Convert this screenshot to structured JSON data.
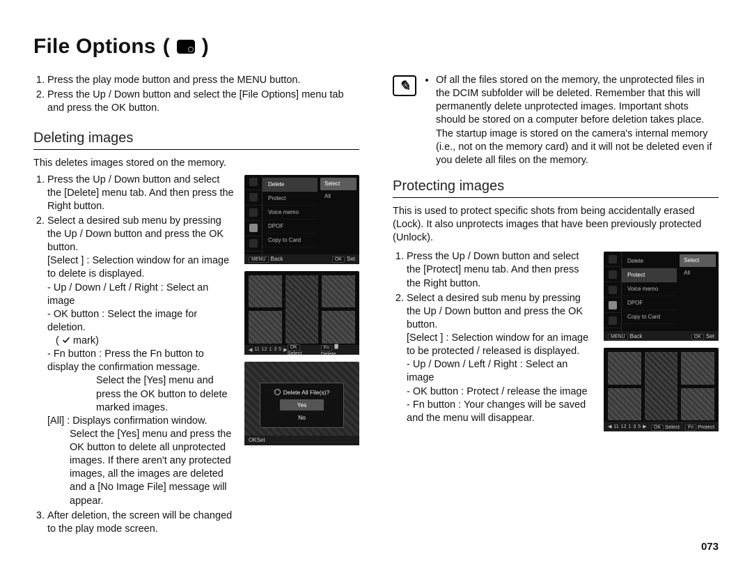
{
  "title": "File Options",
  "paren_open": "(",
  "paren_close": ")",
  "intro_steps": {
    "s1": "Press the play mode button and press the MENU button.",
    "s2": "Press the Up / Down button and select the [File Options] menu tab and press the OK button."
  },
  "deleting": {
    "heading": "Deleting images",
    "lead": "This deletes images stored on the memory.",
    "s1": "Press the Up / Down button and select the [Delete] menu tab. And then press the Right button.",
    "s2": "Select a desired sub menu by pressing the Up / Down button and press the OK button.",
    "select_label": "[Select ] : Selection window for an image to delete is displayed.",
    "nav_line": "- Up / Down / Left / Right : Select an image",
    "ok_line_a": "- OK button : Select the image for deletion.",
    "ok_line_b": "mark)",
    "ok_line_open": "(",
    "fn_line_a": "- Fn button : Press the Fn button to display the confirmation message.",
    "fn_line_b": "Select the [Yes] menu and press the OK button to delete marked images.",
    "all_line_a": "[All] : Displays confirmation window.",
    "all_line_b": "Select the [Yes] menu and press the OK button to delete all unprotected images. If there aren't any protected images, all the images are deleted and a [No Image File] message will appear.",
    "s3": "After deletion, the screen will be changed to the play mode screen."
  },
  "note": {
    "text": "Of all the files stored on the memory, the unprotected files in the DCIM subfolder will be deleted. Remember that this will permanently delete unprotected images. Important shots should be stored on a computer before deletion takes place. The startup image is stored on the camera's internal memory (i.e., not on the memory card) and it will not be deleted even if you delete all files on the memory."
  },
  "protecting": {
    "heading": "Protecting images",
    "lead": "This is used to protect specific shots from being accidentally erased (Lock). It also unprotects images that have been previously protected (Unlock).",
    "s1": "Press the Up / Down button and select the [Protect] menu tab. And then press the Right button.",
    "s2": "Select a desired sub menu by pressing the Up / Down button and press the OK button.",
    "select_label": "[Select ] : Selection window for an image to be protected / released is displayed.",
    "nav_line": "- Up / Down / Left / Right : Select an image",
    "ok_line": "- OK button : Protect / release the image",
    "fn_line": "- Fn button : Your changes will be saved and the menu will disappear."
  },
  "lcd_delete": {
    "rows": {
      "r1": "Delete",
      "r2": "Protect",
      "r3": "Voice memo",
      "r4": "DPOF",
      "r5": "Copy to Card"
    },
    "opts": {
      "o1": "Select",
      "o2": "All"
    },
    "foot_left_btn": "MENU",
    "foot_left": "Back",
    "foot_right_btn": "OK",
    "foot_right": "Set"
  },
  "lcd_protect": {
    "rows": {
      "r1": "Delete",
      "r2": "Protect",
      "r3": "Voice memo",
      "r4": "DPOF",
      "r5": "Copy to Card"
    },
    "opts": {
      "o1": "Select",
      "o2": "All"
    },
    "foot_left_btn": "MENU",
    "foot_left": "Back",
    "foot_right_btn": "OK",
    "foot_right": "Set"
  },
  "thumb_delete": {
    "pages": {
      "p1": "11",
      "p2": "12",
      "p3": "1",
      "p4": "3",
      "p5": "5"
    },
    "ok_btn": "OK",
    "ok_lbl": "Select",
    "fn_btn": "Fn",
    "fn_lbl": "Delete"
  },
  "thumb_protect": {
    "pages": {
      "p1": "11",
      "p2": "12",
      "p3": "1",
      "p4": "3",
      "p5": "5"
    },
    "ok_btn": "OK",
    "ok_lbl": "Select",
    "fn_btn": "Fn",
    "fn_lbl": "Protect"
  },
  "dialog": {
    "title": "Delete All File(s)?",
    "yes": "Yes",
    "no": "No",
    "foot_btn": "OK",
    "foot_lbl": "Set"
  },
  "page_number": "073"
}
